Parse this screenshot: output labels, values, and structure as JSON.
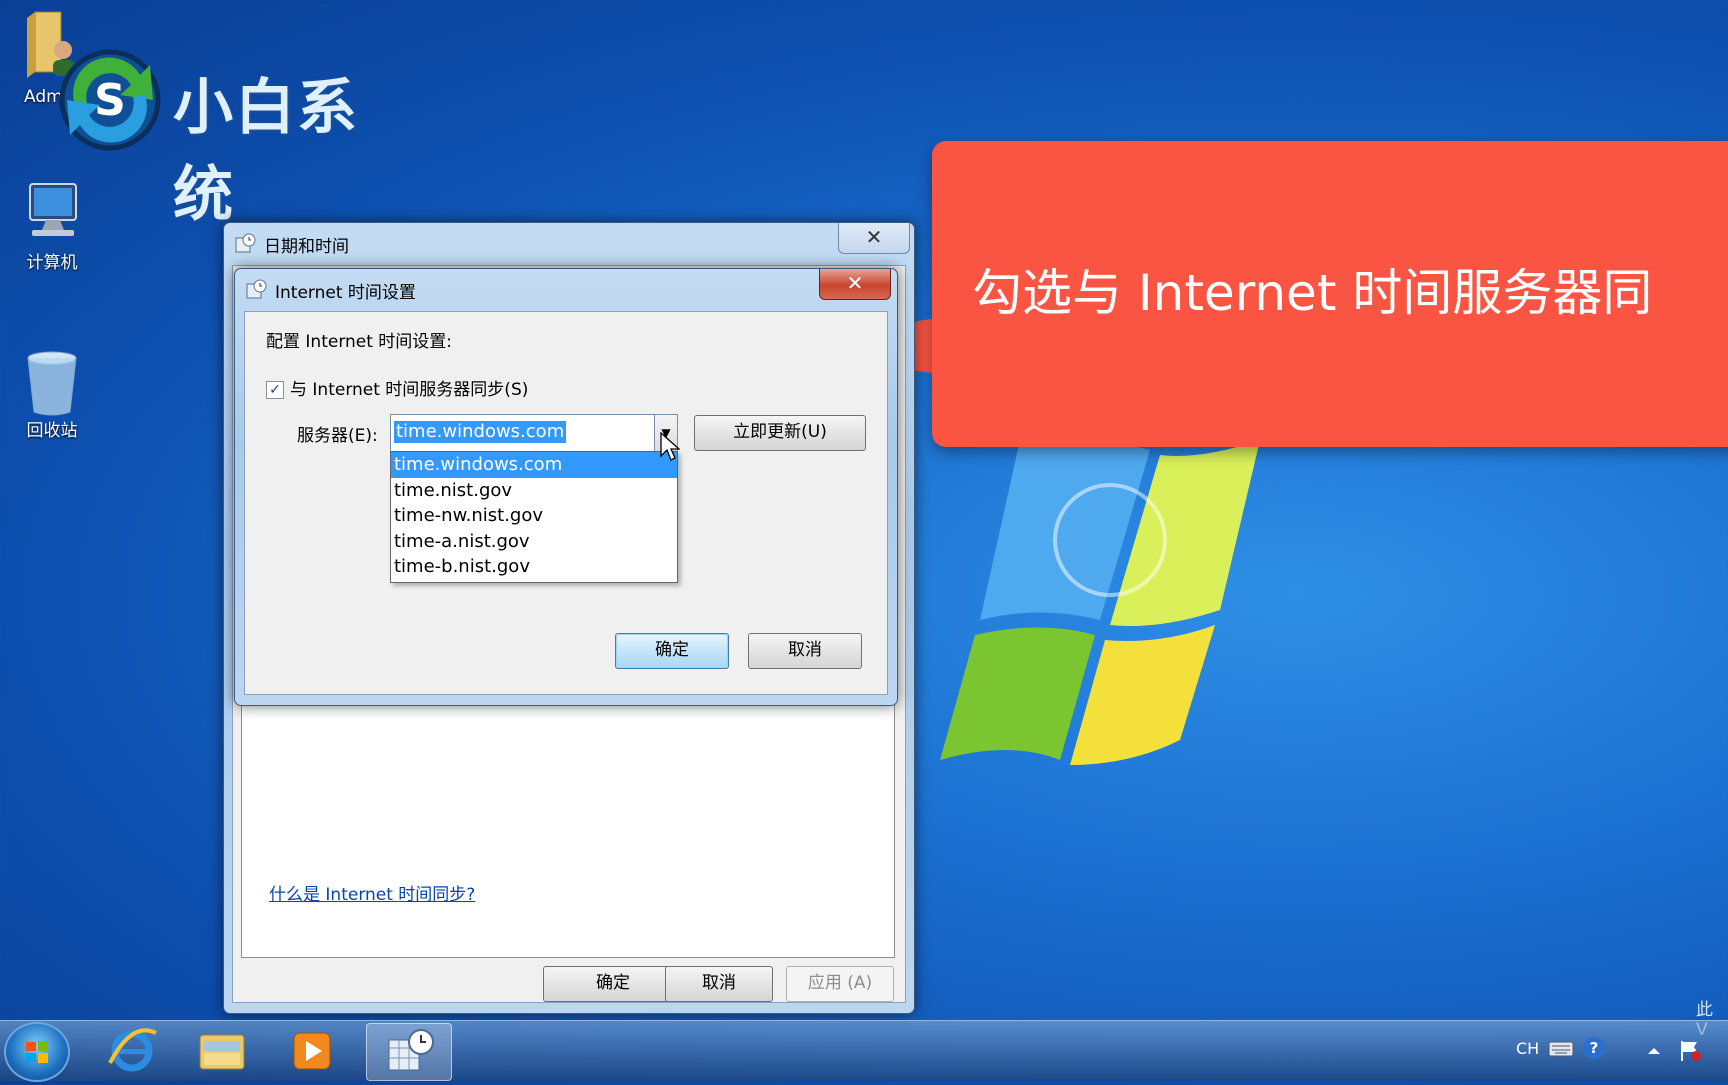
{
  "desktop": {
    "icons": [
      {
        "label": "Adm"
      },
      {
        "label": "计算机"
      },
      {
        "label": "回收站"
      }
    ],
    "logo_text": "小白系统",
    "watermark_text": "此 V"
  },
  "callout": {
    "text": "勾选与 Internet 时间服务器同"
  },
  "datetime_window": {
    "title": "日期和时间",
    "close": "✕",
    "link": "什么是 Internet 时间同步?",
    "ok_label": "确定",
    "cancel_label": "取消",
    "apply_label": "应用 (A)"
  },
  "inet_dialog": {
    "title": "Internet 时间设置",
    "close": "✕",
    "heading": "配置 Internet 时间设置:",
    "sync_checkbox": {
      "label": "与 Internet 时间服务器同步(S)",
      "checked": true,
      "mark": "✓"
    },
    "server_label": "服务器(E):",
    "server_value": "time.windows.com",
    "arrow": "▼",
    "server_options": [
      "time.windows.com",
      "time.nist.gov",
      "time-nw.nist.gov",
      "time-a.nist.gov",
      "time-b.nist.gov"
    ],
    "update_now_label": "立即更新(U)",
    "ok_label": "确定",
    "cancel_label": "取消"
  },
  "taskbar": {
    "language": "CH",
    "help": "?"
  }
}
